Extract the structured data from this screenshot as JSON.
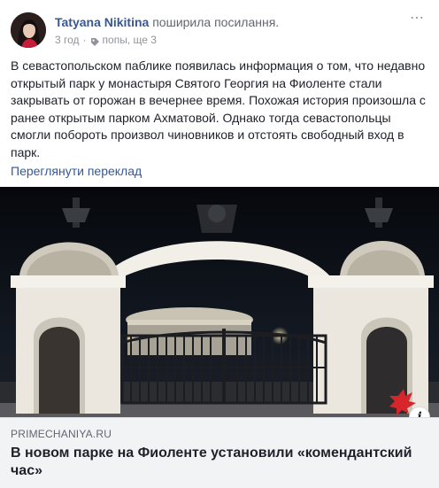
{
  "post": {
    "author": {
      "name": "Tatyana Nikitina",
      "action": "поширила посилання."
    },
    "meta": {
      "time": "3 год",
      "audience": "попы, ще 3"
    },
    "body": "В севастопольском паблике появилась информация о том, что недавно открытый парк у монастыря Святого Георгия на Фиоленте стали закрывать от горожан в вечернее время. Похожая история произошла с ранее открытым парком Ахматовой. Однако тогда севастопольцы смогли побороть произвол чиновников и отстоять свободный вход в парк.",
    "translate_label": "Переглянути переклад",
    "icons": {
      "options": "more-options-icon",
      "audience": "tag-icon",
      "info": "info-icon"
    }
  },
  "link_preview": {
    "domain": "PRIMECHANIYA.RU",
    "title": "В новом парке на Фиоленте установили «комендантский час»",
    "info_label": "i"
  },
  "colors": {
    "link": "#365899",
    "text": "#1d2129",
    "meta": "#90949c",
    "caption_bg": "#f2f3f5"
  }
}
